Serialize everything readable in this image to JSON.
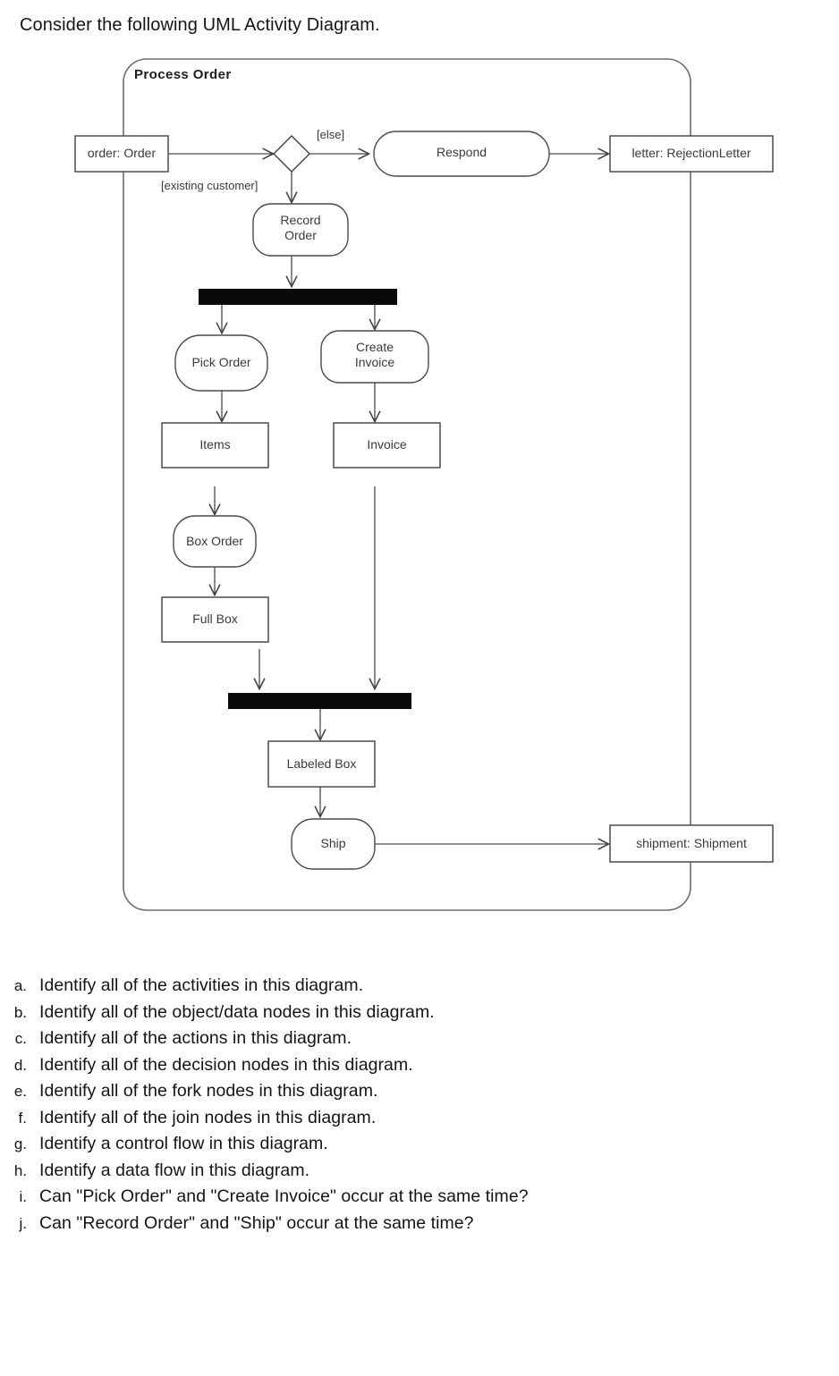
{
  "prompt": "Consider the following UML Activity Diagram.",
  "diagram": {
    "activity_name": "Process Order",
    "type": "uml-activity-diagram",
    "nodes": [
      {
        "id": "order",
        "kind": "object-node",
        "label": "order: Order"
      },
      {
        "id": "decision",
        "kind": "decision-node",
        "label": ""
      },
      {
        "id": "respond",
        "kind": "action",
        "label": "Respond"
      },
      {
        "id": "letter",
        "kind": "object-node",
        "label": "letter: RejectionLetter"
      },
      {
        "id": "record-order",
        "kind": "action",
        "label": "Record\nOrder"
      },
      {
        "id": "fork",
        "kind": "fork-node",
        "label": ""
      },
      {
        "id": "pick-order",
        "kind": "action",
        "label": "Pick Order"
      },
      {
        "id": "create-invoice",
        "kind": "action",
        "label": "Create\nInvoice"
      },
      {
        "id": "items",
        "kind": "object-node",
        "label": "Items"
      },
      {
        "id": "invoice",
        "kind": "object-node",
        "label": "Invoice"
      },
      {
        "id": "box-order",
        "kind": "action",
        "label": "Box Order"
      },
      {
        "id": "full-box",
        "kind": "object-node",
        "label": "Full Box"
      },
      {
        "id": "join",
        "kind": "join-node",
        "label": ""
      },
      {
        "id": "labeled-box",
        "kind": "object-node",
        "label": "Labeled Box"
      },
      {
        "id": "ship",
        "kind": "action",
        "label": "Ship"
      },
      {
        "id": "shipment",
        "kind": "object-node",
        "label": "shipment: Shipment"
      }
    ],
    "guards": {
      "else": "[else]",
      "existing_customer": "[existing customer]"
    },
    "edges": [
      {
        "from": "order",
        "to": "decision"
      },
      {
        "from": "decision",
        "to": "respond",
        "guard": "[else]"
      },
      {
        "from": "decision",
        "to": "record-order",
        "guard": "[existing customer]"
      },
      {
        "from": "respond",
        "to": "letter"
      },
      {
        "from": "record-order",
        "to": "fork"
      },
      {
        "from": "fork",
        "to": "pick-order"
      },
      {
        "from": "fork",
        "to": "create-invoice"
      },
      {
        "from": "pick-order",
        "to": "items"
      },
      {
        "from": "create-invoice",
        "to": "invoice"
      },
      {
        "from": "items",
        "to": "box-order"
      },
      {
        "from": "box-order",
        "to": "full-box"
      },
      {
        "from": "full-box",
        "to": "join"
      },
      {
        "from": "invoice",
        "to": "join"
      },
      {
        "from": "join",
        "to": "labeled-box"
      },
      {
        "from": "labeled-box",
        "to": "ship"
      },
      {
        "from": "ship",
        "to": "shipment"
      }
    ]
  },
  "questions": [
    {
      "marker": "a.",
      "text": "Identify all of the activities in this diagram."
    },
    {
      "marker": "b.",
      "text": "Identify all of the object/data nodes in this diagram."
    },
    {
      "marker": "c.",
      "text": "Identify all of the actions in this diagram."
    },
    {
      "marker": "d.",
      "text": "Identify all of the decision nodes in this diagram."
    },
    {
      "marker": "e.",
      "text": "Identify all of the fork nodes in this diagram."
    },
    {
      "marker": "f.",
      "text": "Identify all of the join nodes in this diagram."
    },
    {
      "marker": "g.",
      "text": "Identify a control flow in this diagram."
    },
    {
      "marker": "h.",
      "text": "Identify a data flow in this diagram."
    },
    {
      "marker": "i.",
      "text": "Can \"Pick Order\" and \"Create Invoice\" occur at the same time?"
    },
    {
      "marker": "j.",
      "text": "Can \"Record Order\" and \"Ship\" occur at the same time?"
    }
  ]
}
